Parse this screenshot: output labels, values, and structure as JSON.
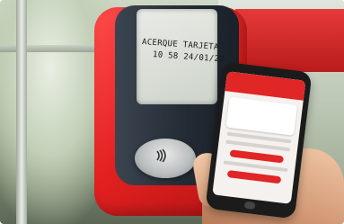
{
  "validator_screen": {
    "line1": "ACERQUE TARJETA",
    "line2": "10 58 24/01/22"
  },
  "icons": {
    "contactless": "contactless-icon"
  }
}
